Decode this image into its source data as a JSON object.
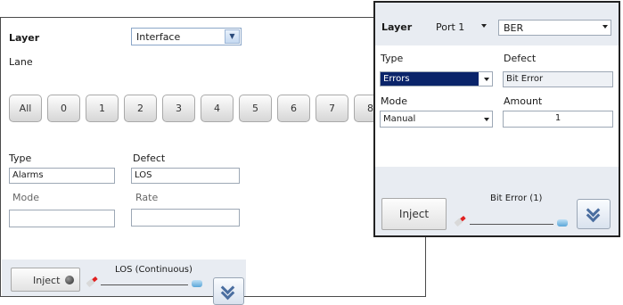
{
  "interface_panel": {
    "layer_label": "Layer",
    "layer_value": "Interface",
    "lane_label": "Lane",
    "lanes": [
      "All",
      "0",
      "1",
      "2",
      "3",
      "4",
      "5",
      "6",
      "7",
      "8"
    ],
    "type_label": "Type",
    "defect_label": "Defect",
    "type_value": "Alarms",
    "defect_value": "LOS",
    "mode_label": "Mode",
    "rate_label": "Rate",
    "mode_value": "",
    "rate_value": "",
    "inject_label": "Inject",
    "status_text": "LOS (Continuous)"
  },
  "ber_panel": {
    "layer_label": "Layer",
    "port_value": "Port 1",
    "layer_value": "BER",
    "type_label": "Type",
    "defect_label": "Defect",
    "type_value": "Errors",
    "defect_value": "Bit Error",
    "mode_label": "Mode",
    "amount_label": "Amount",
    "mode_value": "Manual",
    "amount_value": "1",
    "inject_label": "Inject",
    "status_text": "Bit Error (1)"
  },
  "colors": {
    "selection": "#0a246a",
    "footer_bg": "#e8ecf2",
    "expand_chevron": "#4a6ea0"
  },
  "icons": [
    "dropdown-arrow-icon",
    "led-indicator-icon",
    "marker-icon",
    "reel-icon",
    "expand-chevron-icon"
  ]
}
